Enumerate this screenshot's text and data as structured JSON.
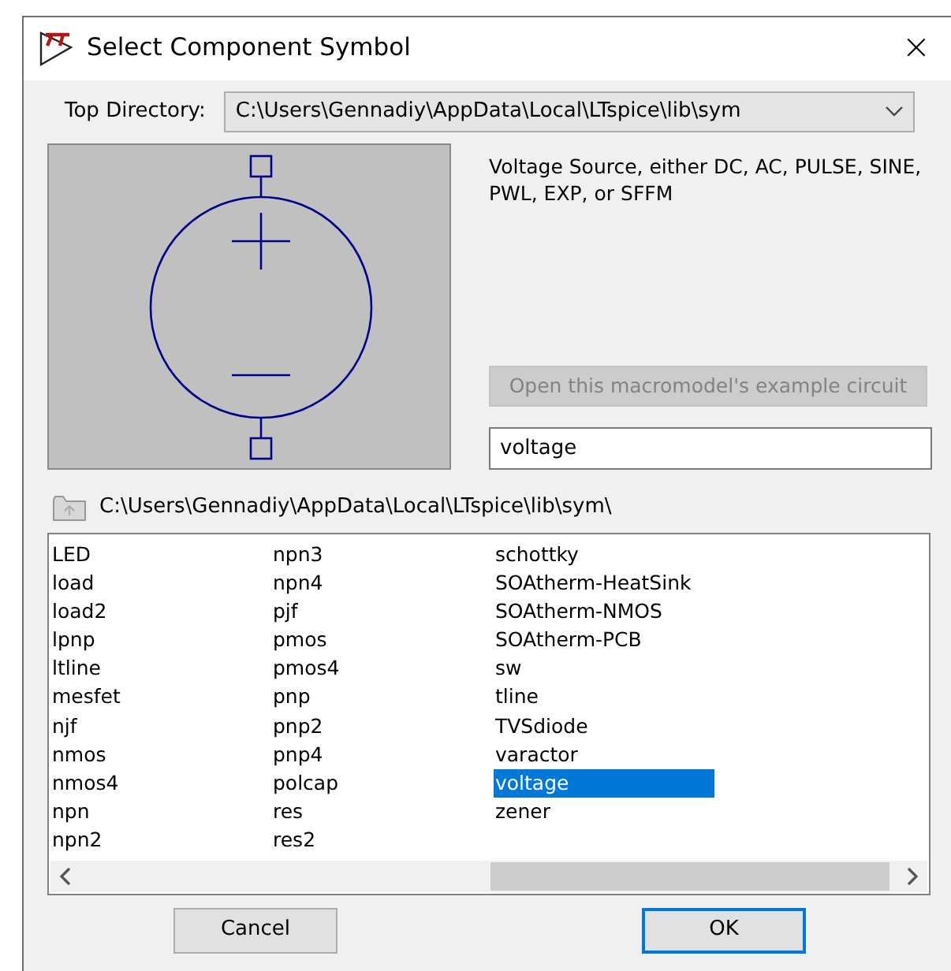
{
  "window": {
    "title": "Select Component Symbol",
    "close": "×"
  },
  "top_directory": {
    "label": "Top Directory:",
    "value": "C:\\Users\\Gennadiy\\AppData\\Local\\LTspice\\lib\\sym"
  },
  "description": "Voltage Source, either DC, AC, PULSE, SINE, PWL, EXP, or SFFM",
  "example_button": {
    "label": "Open this macromodel's example circuit",
    "disabled": true
  },
  "search": {
    "value": "voltage"
  },
  "folder_path": "C:\\Users\\Gennadiy\\AppData\\Local\\LTspice\\lib\\sym\\",
  "file_list": {
    "columns": [
      [
        {
          "name": "LED",
          "selected": false
        },
        {
          "name": "load",
          "selected": false
        },
        {
          "name": "load2",
          "selected": false
        },
        {
          "name": "lpnp",
          "selected": false
        },
        {
          "name": "ltline",
          "selected": false
        },
        {
          "name": "mesfet",
          "selected": false
        },
        {
          "name": "njf",
          "selected": false
        },
        {
          "name": "nmos",
          "selected": false
        },
        {
          "name": "nmos4",
          "selected": false
        },
        {
          "name": "npn",
          "selected": false
        },
        {
          "name": "npn2",
          "selected": false
        }
      ],
      [
        {
          "name": "npn3",
          "selected": false
        },
        {
          "name": "npn4",
          "selected": false
        },
        {
          "name": "pjf",
          "selected": false
        },
        {
          "name": "pmos",
          "selected": false
        },
        {
          "name": "pmos4",
          "selected": false
        },
        {
          "name": "pnp",
          "selected": false
        },
        {
          "name": "pnp2",
          "selected": false
        },
        {
          "name": "pnp4",
          "selected": false
        },
        {
          "name": "polcap",
          "selected": false
        },
        {
          "name": "res",
          "selected": false
        },
        {
          "name": "res2",
          "selected": false
        }
      ],
      [
        {
          "name": "schottky",
          "selected": false
        },
        {
          "name": "SOAtherm-HeatSink",
          "selected": false
        },
        {
          "name": "SOAtherm-NMOS",
          "selected": false
        },
        {
          "name": "SOAtherm-PCB",
          "selected": false
        },
        {
          "name": "sw",
          "selected": false
        },
        {
          "name": "tline",
          "selected": false
        },
        {
          "name": "TVSdiode",
          "selected": false
        },
        {
          "name": "varactor",
          "selected": false
        },
        {
          "name": "voltage",
          "selected": true
        },
        {
          "name": "zener",
          "selected": false
        }
      ]
    ]
  },
  "buttons": [
    {
      "label": "Cancel",
      "default": false
    },
    {
      "label": "OK",
      "default": true
    }
  ]
}
